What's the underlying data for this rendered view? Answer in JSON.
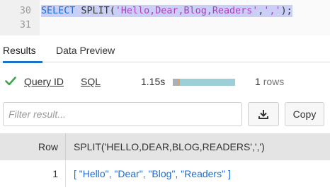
{
  "editor": {
    "lines": [
      {
        "number": "30",
        "tokens": {
          "keyword": "SELECT",
          "func": " SPLIT(",
          "string1": "'Hello,Dear,Blog,Readers'",
          "comma": ",",
          "string2": "','",
          "end": ");"
        }
      },
      {
        "number": "31"
      }
    ]
  },
  "tabs": [
    {
      "label": "Results",
      "active": true
    },
    {
      "label": "Data Preview",
      "active": false
    }
  ],
  "status": {
    "icon": "check-icon",
    "query_id_label": "Query ID",
    "sql_label": "SQL",
    "duration": "1.15s",
    "progress_fraction": 0.1,
    "row_count": "1",
    "row_unit": "rows"
  },
  "filter": {
    "placeholder": "Filter result...",
    "download_icon": "download-icon",
    "copy_label": "Copy"
  },
  "table": {
    "row_header": "Row",
    "column_header": "SPLIT('HELLO,DEAR,BLOG,READERS',',')",
    "rows": [
      {
        "row": "1",
        "value": "[ \"Hello\", \"Dear\", \"Blog\", \"Readers\" ]"
      }
    ]
  },
  "colors": {
    "accent": "#1a73c7",
    "success": "#3aa54a",
    "link_value": "#1a6ed8",
    "selection": "#c9cff5"
  }
}
